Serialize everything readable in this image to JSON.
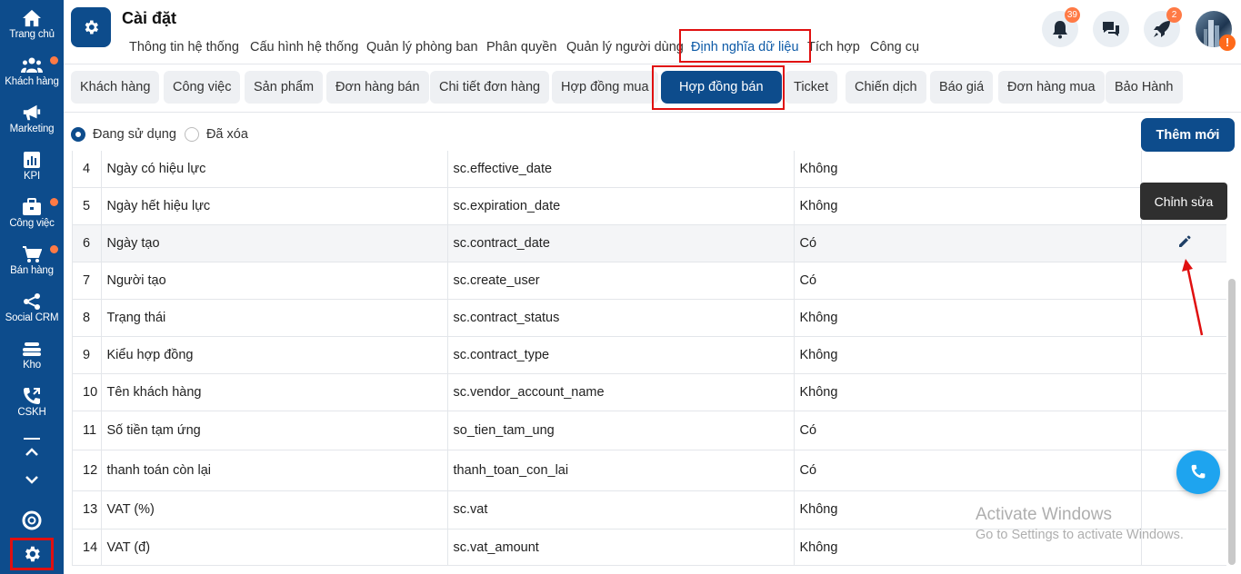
{
  "sidebar": {
    "items": [
      {
        "label": "Trang chủ",
        "icon": "home-icon",
        "dot": false
      },
      {
        "label": "Khách hàng",
        "icon": "users-icon",
        "dot": true
      },
      {
        "label": "Marketing",
        "icon": "megaphone-icon",
        "dot": false
      },
      {
        "label": "KPI",
        "icon": "chart-icon",
        "dot": false
      },
      {
        "label": "Công việc",
        "icon": "briefcase-icon",
        "dot": true
      },
      {
        "label": "Bán hàng",
        "icon": "cart-icon",
        "dot": true
      },
      {
        "label": "Social CRM",
        "icon": "share-icon",
        "dot": false
      },
      {
        "label": "Kho",
        "icon": "warehouse-icon",
        "dot": false
      },
      {
        "label": "CSKH",
        "icon": "phone-icon",
        "dot": false
      }
    ]
  },
  "header": {
    "title": "Cài đặt",
    "tabs": [
      {
        "label": "Thông tin hệ thống"
      },
      {
        "label": "Cấu hình hệ thống"
      },
      {
        "label": "Quản lý phòng ban"
      },
      {
        "label": "Phân quyền"
      },
      {
        "label": "Quản lý người dùng"
      },
      {
        "label": "Định nghĩa dữ liệu",
        "active": true
      },
      {
        "label": "Tích hợp"
      },
      {
        "label": "Công cụ"
      }
    ],
    "notifications_count": "39",
    "rocket_count": "2",
    "avatar_warning": "!"
  },
  "subtabs": [
    {
      "label": "Khách hàng"
    },
    {
      "label": "Công việc"
    },
    {
      "label": "Sản phẩm"
    },
    {
      "label": "Đơn hàng bán"
    },
    {
      "label": "Chi tiết đơn hàng"
    },
    {
      "label": "Hợp đồng mua"
    },
    {
      "label": "Hợp đồng bán",
      "active": true
    },
    {
      "label": "Ticket"
    },
    {
      "label": "Chiến dịch"
    },
    {
      "label": "Báo giá"
    },
    {
      "label": "Đơn hàng mua"
    },
    {
      "label": "Bảo Hành"
    }
  ],
  "filter": {
    "in_use_label": "Đang sử dụng",
    "deleted_label": "Đã xóa",
    "selected": "in_use"
  },
  "add_button_label": "Thêm mới",
  "tooltip_label": "Chỉnh sửa",
  "rows": [
    {
      "num": "4",
      "name": "Ngày có hiệu lực",
      "key": "sc.effective_date",
      "required": "Không"
    },
    {
      "num": "5",
      "name": "Ngày hết hiệu lực",
      "key": "sc.expiration_date",
      "required": "Không"
    },
    {
      "num": "6",
      "name": "Ngày tạo",
      "key": "sc.contract_date",
      "required": "Có",
      "hover": true
    },
    {
      "num": "7",
      "name": "Người tạo",
      "key": "sc.create_user",
      "required": "Có"
    },
    {
      "num": "8",
      "name": "Trạng thái",
      "key": "sc.contract_status",
      "required": "Không"
    },
    {
      "num": "9",
      "name": "Kiểu hợp đồng",
      "key": "sc.contract_type",
      "required": "Không"
    },
    {
      "num": "10",
      "name": "Tên khách hàng",
      "key": "sc.vendor_account_name",
      "required": "Không"
    },
    {
      "num": "11",
      "name": "Số tiền tạm ứng",
      "key": "so_tien_tam_ung",
      "required": "Có"
    },
    {
      "num": "12",
      "name": "thanh toán còn lại",
      "key": "thanh_toan_con_lai",
      "required": "Có"
    },
    {
      "num": "13",
      "name": "VAT (%)",
      "key": "sc.vat",
      "required": "Không"
    },
    {
      "num": "14",
      "name": "VAT (đ)",
      "key": "sc.vat_amount",
      "required": "Không"
    }
  ],
  "watermark": {
    "line1": "Activate Windows",
    "line2": "Go to Settings to activate Windows."
  },
  "colors": {
    "brand": "#0d4c8c",
    "accent_badge": "#ff7a45",
    "highlight": "#e01010",
    "fab": "#1ea4ef"
  }
}
